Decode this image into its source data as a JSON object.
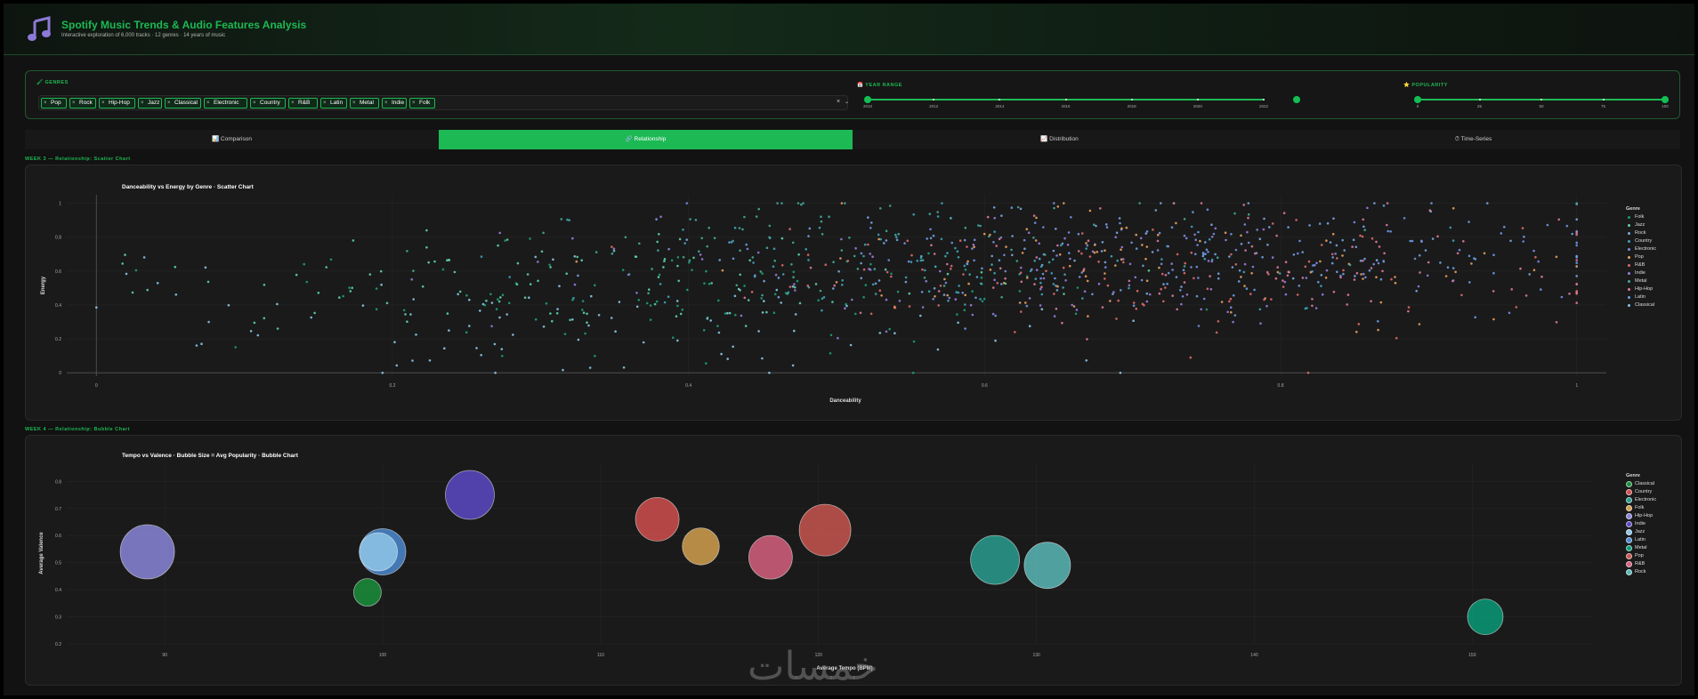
{
  "app": {
    "title": "Spotify Music Trends & Audio Features Analysis",
    "subtitle": "Interactive exploration of 6,000 tracks · 12 genres · 14 years of music",
    "logo_icon": "music-note-icon"
  },
  "filters": {
    "genres_label": "GENRES",
    "genres": [
      "Pop",
      "Rock",
      "Hip-Hop",
      "Jazz",
      "Classical",
      "Electronic",
      "Country",
      "R&B",
      "Latin",
      "Metal",
      "Indie",
      "Folk"
    ],
    "clear_label": "×",
    "dropdown_label": "⌄",
    "year_label": "YEAR RANGE",
    "year_ticks": [
      "2010",
      "2012",
      "2014",
      "2016",
      "2018",
      "2020",
      "2022"
    ],
    "year_range": [
      2010,
      2023
    ],
    "popularity_label": "POPULARITY",
    "pop_ticks": [
      "0",
      "25",
      "50",
      "75",
      "100"
    ],
    "pop_range": [
      0,
      100
    ]
  },
  "tabs": [
    {
      "label": "📊 Comparison",
      "active": false
    },
    {
      "label": "🔗 Relationship",
      "active": true
    },
    {
      "label": "📈 Distribution",
      "active": false
    },
    {
      "label": "⏱ Time-Series",
      "active": false
    }
  ],
  "sections": {
    "scatter_label": "WEEK 3 — Relationship: Scatter Chart",
    "bubble_label": "WEEK 4 — Relationship: Bubble Chart"
  },
  "colors": {
    "accent": "#1db954",
    "Folk": "#1d9e75",
    "Jazz": "#5dd4a6",
    "Rock": "#7aa6e6",
    "Country": "#3fa4b8",
    "Electronic": "#7a8ee6",
    "Pop": "#e8a060",
    "R&B": "#e06a6a",
    "Indie": "#9a7ce0",
    "Metal": "#44aa99",
    "Hip-Hop": "#e07aa0",
    "Latin": "#6aa0e6",
    "Classical": "#88c8e6"
  },
  "chart_data": [
    {
      "type": "scatter",
      "title": "Danceability vs Energy by Genre · Scatter Chart",
      "xlabel": "Danceability",
      "ylabel": "Energy",
      "xlim": [
        -0.02,
        1.02
      ],
      "ylim": [
        -0.02,
        1.05
      ],
      "x_ticks": [
        0,
        0.2,
        0.4,
        0.6,
        0.8,
        1
      ],
      "y_ticks": [
        0,
        0.2,
        0.4,
        0.6,
        0.8,
        1
      ],
      "legend_title": "Genre",
      "legend_position": "right",
      "series": [
        {
          "name": "Folk",
          "color": "#1d9e75",
          "dance_center": 0.38,
          "energy_center": 0.45
        },
        {
          "name": "Jazz",
          "color": "#5dd4a6",
          "dance_center": 0.32,
          "energy_center": 0.55
        },
        {
          "name": "Rock",
          "color": "#7aa6e6",
          "dance_center": 0.72,
          "energy_center": 0.72
        },
        {
          "name": "Country",
          "color": "#3fa4b8",
          "dance_center": 0.6,
          "energy_center": 0.62
        },
        {
          "name": "Electronic",
          "color": "#7a8ee6",
          "dance_center": 0.75,
          "energy_center": 0.7
        },
        {
          "name": "Pop",
          "color": "#e8a060",
          "dance_center": 0.7,
          "energy_center": 0.62
        },
        {
          "name": "R&B",
          "color": "#e06a6a",
          "dance_center": 0.68,
          "energy_center": 0.55
        },
        {
          "name": "Indie",
          "color": "#9a7ce0",
          "dance_center": 0.62,
          "energy_center": 0.58
        },
        {
          "name": "Metal",
          "color": "#44aa99",
          "dance_center": 0.5,
          "energy_center": 0.8
        },
        {
          "name": "Hip-Hop",
          "color": "#e07aa0",
          "dance_center": 0.78,
          "energy_center": 0.6
        },
        {
          "name": "Latin",
          "color": "#6aa0e6",
          "dance_center": 0.76,
          "energy_center": 0.68
        },
        {
          "name": "Classical",
          "color": "#88c8e6",
          "dance_center": 0.35,
          "energy_center": 0.3
        }
      ]
    },
    {
      "type": "bubble",
      "title": "Tempo vs Valence · Bubble Size = Avg Popularity · Bubble Chart",
      "xlabel": "Average Tempo (BPM)",
      "ylabel": "Average Valence",
      "xlim": [
        85.5,
        155.5
      ],
      "ylim": [
        0.2,
        0.87
      ],
      "x_ticks": [
        90,
        100,
        110,
        120,
        130,
        140,
        150
      ],
      "y_ticks": [
        0.2,
        0.3,
        0.4,
        0.5,
        0.6,
        0.7,
        0.8
      ],
      "legend_title": "Genre",
      "legend_position": "right",
      "points": [
        {
          "genre": "Classical",
          "tempo": 99.3,
          "valence": 0.39,
          "popularity": 36,
          "color": "#1a8f3c"
        },
        {
          "genre": "Country",
          "tempo": 112.6,
          "valence": 0.66,
          "popularity": 48,
          "color": "#d0504e"
        },
        {
          "genre": "Electronic",
          "tempo": 128.1,
          "valence": 0.51,
          "popularity": 52,
          "color": "#2a9d8f"
        },
        {
          "genre": "Folk",
          "tempo": 114.6,
          "valence": 0.56,
          "popularity": 43,
          "color": "#d1a04f"
        },
        {
          "genre": "Hip-Hop",
          "tempo": 89.2,
          "valence": 0.54,
          "popularity": 56,
          "color": "#8a86d9"
        },
        {
          "genre": "Indie",
          "tempo": 104.0,
          "valence": 0.75,
          "popularity": 52,
          "color": "#5b4ac4"
        },
        {
          "genre": "Jazz",
          "tempo": 99.8,
          "valence": 0.54,
          "popularity": 44,
          "color": "#8fc6e6"
        },
        {
          "genre": "Latin",
          "tempo": 100.0,
          "valence": 0.54,
          "popularity": 50,
          "color": "#4b89d0"
        },
        {
          "genre": "Metal",
          "tempo": 150.6,
          "valence": 0.3,
          "popularity": 42,
          "color": "#0a9a78"
        },
        {
          "genre": "Pop",
          "tempo": 120.3,
          "valence": 0.62,
          "popularity": 54,
          "color": "#c8564f"
        },
        {
          "genre": "R&B",
          "tempo": 117.8,
          "valence": 0.52,
          "popularity": 48,
          "color": "#d6607e"
        },
        {
          "genre": "Rock",
          "tempo": 130.5,
          "valence": 0.49,
          "popularity": 50,
          "color": "#5bb8b8"
        }
      ]
    }
  ]
}
